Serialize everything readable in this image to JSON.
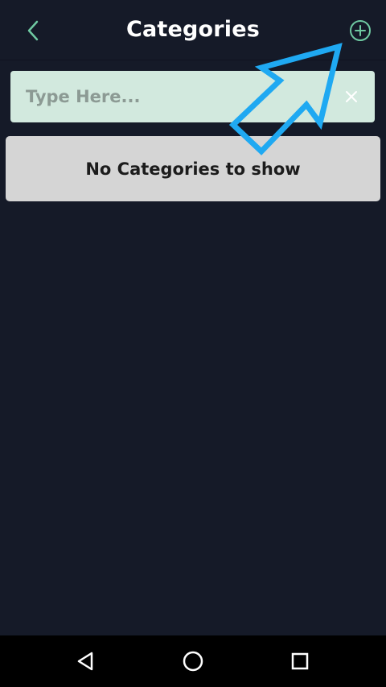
{
  "header": {
    "title": "Categories",
    "back_icon": "chevron-left-icon",
    "add_icon": "plus-circle-icon"
  },
  "search": {
    "placeholder": "Type Here...",
    "value": "",
    "clear_icon": "close-icon"
  },
  "empty_state": {
    "message": "No Categories to show"
  },
  "nav_bar": {
    "back_icon": "triangle-back-icon",
    "home_icon": "circle-home-icon",
    "recents_icon": "square-recents-icon"
  },
  "colors": {
    "background": "#151a28",
    "accent": "#6fc9a2",
    "search_bg": "#d2e9de",
    "empty_bg": "#d5d5d5",
    "annotation_arrow": "#1fa9f2"
  }
}
